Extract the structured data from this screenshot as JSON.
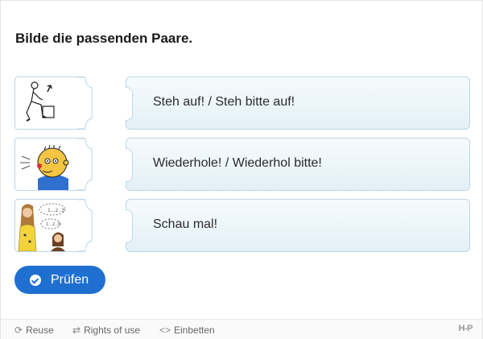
{
  "task": {
    "title": "Bilde die passenden Paare."
  },
  "pairs": [
    {
      "image_name": "person-standing-up-image",
      "text": "Steh auf! / Steh bitte auf!"
    },
    {
      "image_name": "boy-speaking-image",
      "text": "Wiederhole! / Wiederhol bitte!"
    },
    {
      "image_name": "two-people-talking-image",
      "text": "Schau mal!"
    }
  ],
  "actions": {
    "check_label": "Prüfen",
    "check_icon": "check-circle-icon"
  },
  "footer": {
    "reuse_label": "Reuse",
    "rights_label": "Rights of use",
    "embed_label": "Einbetten",
    "logo_text": "H-P"
  },
  "colors": {
    "button": "#1f6fd0",
    "card_border": "#bcd6e6",
    "card_bg": "#e3f0f6"
  }
}
